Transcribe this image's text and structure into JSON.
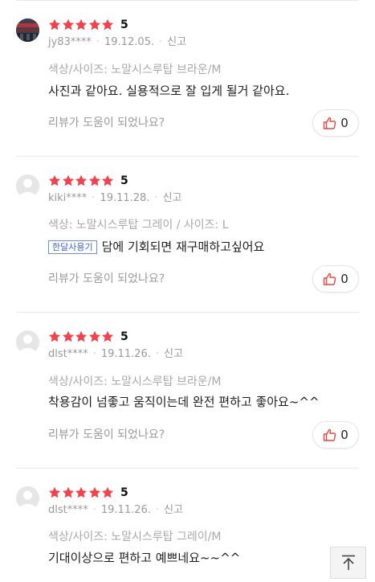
{
  "colors": {
    "star": "#f0434b",
    "like_icon": "#e8453c",
    "badge_border": "#6b8fd6"
  },
  "reviews": [
    {
      "avatar": "photo-avatar",
      "rating": 5,
      "score": "5",
      "user": "jy83****",
      "date": "19.12.05.",
      "report": "신고",
      "option": "색상/사이즈: 노말시스루탑 브라운/M",
      "badge": "",
      "content": "사진과 같아요. 실용적으로  잘 입게 될거 같아요.",
      "helpful_prompt": "리뷰가 도움이 되었나요?",
      "likes": "0"
    },
    {
      "avatar": "default-avatar",
      "rating": 5,
      "score": "5",
      "user": "kiki****",
      "date": "19.11.28.",
      "report": "신고",
      "option": "색상: 노말시스루탑 그레이 / 사이즈: L",
      "badge": "한달사용기",
      "content": "담에 기회되면 재구매하고싶어요",
      "helpful_prompt": "리뷰가 도움이 되었나요?",
      "likes": "0"
    },
    {
      "avatar": "default-avatar",
      "rating": 5,
      "score": "5",
      "user": "dlst****",
      "date": "19.11.26.",
      "report": "신고",
      "option": "색상/사이즈: 노말시스루탑 브라운/M",
      "badge": "",
      "content": "착용감이 넘좋고 움직이는데 완전 편하고 좋아요~^^",
      "helpful_prompt": "리뷰가 도움이 되었나요?",
      "likes": "0"
    },
    {
      "avatar": "default-avatar",
      "rating": 5,
      "score": "5",
      "user": "dlst****",
      "date": "19.11.26.",
      "report": "신고",
      "option": "색상/사이즈: 노말시스루탑 그레이/M",
      "badge": "",
      "content": "기대이상으로 편하고 예쁘네요~~^^",
      "helpful_prompt": "",
      "likes": ""
    }
  ]
}
